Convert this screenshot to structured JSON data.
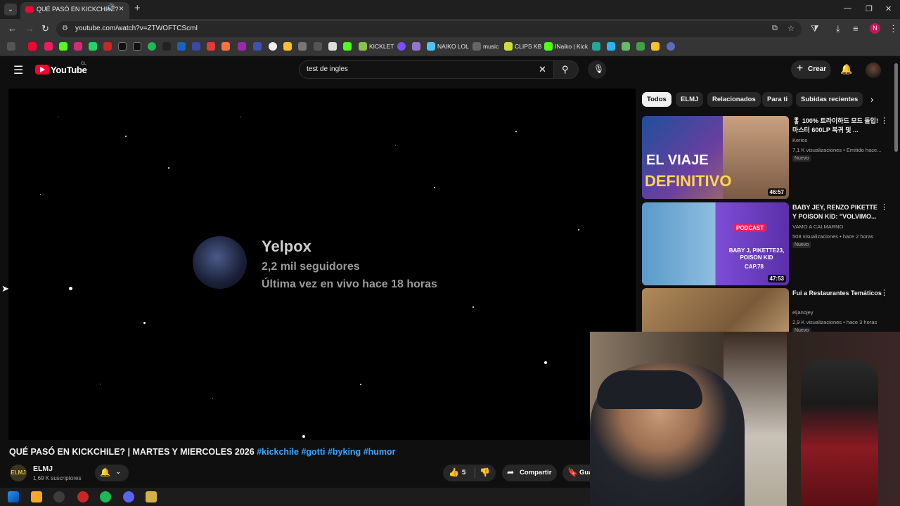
{
  "browser": {
    "tab_title": "QUÉ PASÓ EN KICKCHILE?",
    "url": "youtube.com/watch?v=ZTWOFTCScmI",
    "profile_initial": "N",
    "bookmarks": [
      {
        "label": "KICKLET"
      },
      {
        "label": "NAIKO LOL"
      },
      {
        "label": "music"
      },
      {
        "label": "CLIPS KB"
      },
      {
        "label": "INaiko | Kick"
      }
    ]
  },
  "youtube": {
    "logo_text": "YouTube",
    "country": "CL",
    "search_query": "test de ingles",
    "create_label": "Crear"
  },
  "player": {
    "channel_name": "Yelpox",
    "followers": "2,2 mil seguidores",
    "last_live": "Última vez en vivo hace 18 horas"
  },
  "video": {
    "title": "QUÉ PASÓ EN KICKCHILE? | MARTES Y MIERCOLES 2026",
    "hashtags": [
      "#kickchile",
      "#gotti",
      "#byking",
      "#humor"
    ],
    "channel_avatar_text": "ELMJ",
    "channel_name": "ELMJ",
    "subscribers": "1,69 K suscriptores",
    "likes": "5",
    "share_label": "Compartir",
    "save_label": "Guardar"
  },
  "chips": [
    "Todos",
    "ELMJ",
    "Relacionados",
    "Para ti",
    "Subidas recientes"
  ],
  "related": [
    {
      "title": "🎖 100% 트라이하드 모드 돌입! 마스터 600LP 복귀 및 ...",
      "channel": "Kerios",
      "stats": "7,1 K visualizaciones • Emitido hace...",
      "badge": "Nuevo",
      "duration": "46:57",
      "thumb_text_1": "EL VIAJE",
      "thumb_text_2": "DEFINITIVO"
    },
    {
      "title": "BABY JEY, RENZO PIKETTE Y POISON KID: \"VOLVIMO...",
      "channel": "VAMO A CALMARNO",
      "stats": "508 visualizaciones • hace 2 horas",
      "badge": "Nuevo",
      "duration": "47:53",
      "thumb_text_1": "PODCAST",
      "thumb_text_2": "BABY J, PIKETTE23, POISON KID",
      "thumb_text_3": "CAP.78"
    },
    {
      "title": "Fui a Restaurantes Temáticos",
      "channel": "eljanojey",
      "stats": "2,9 K visualizaciones • hace 3 horas",
      "badge": "Nuevo"
    }
  ]
}
